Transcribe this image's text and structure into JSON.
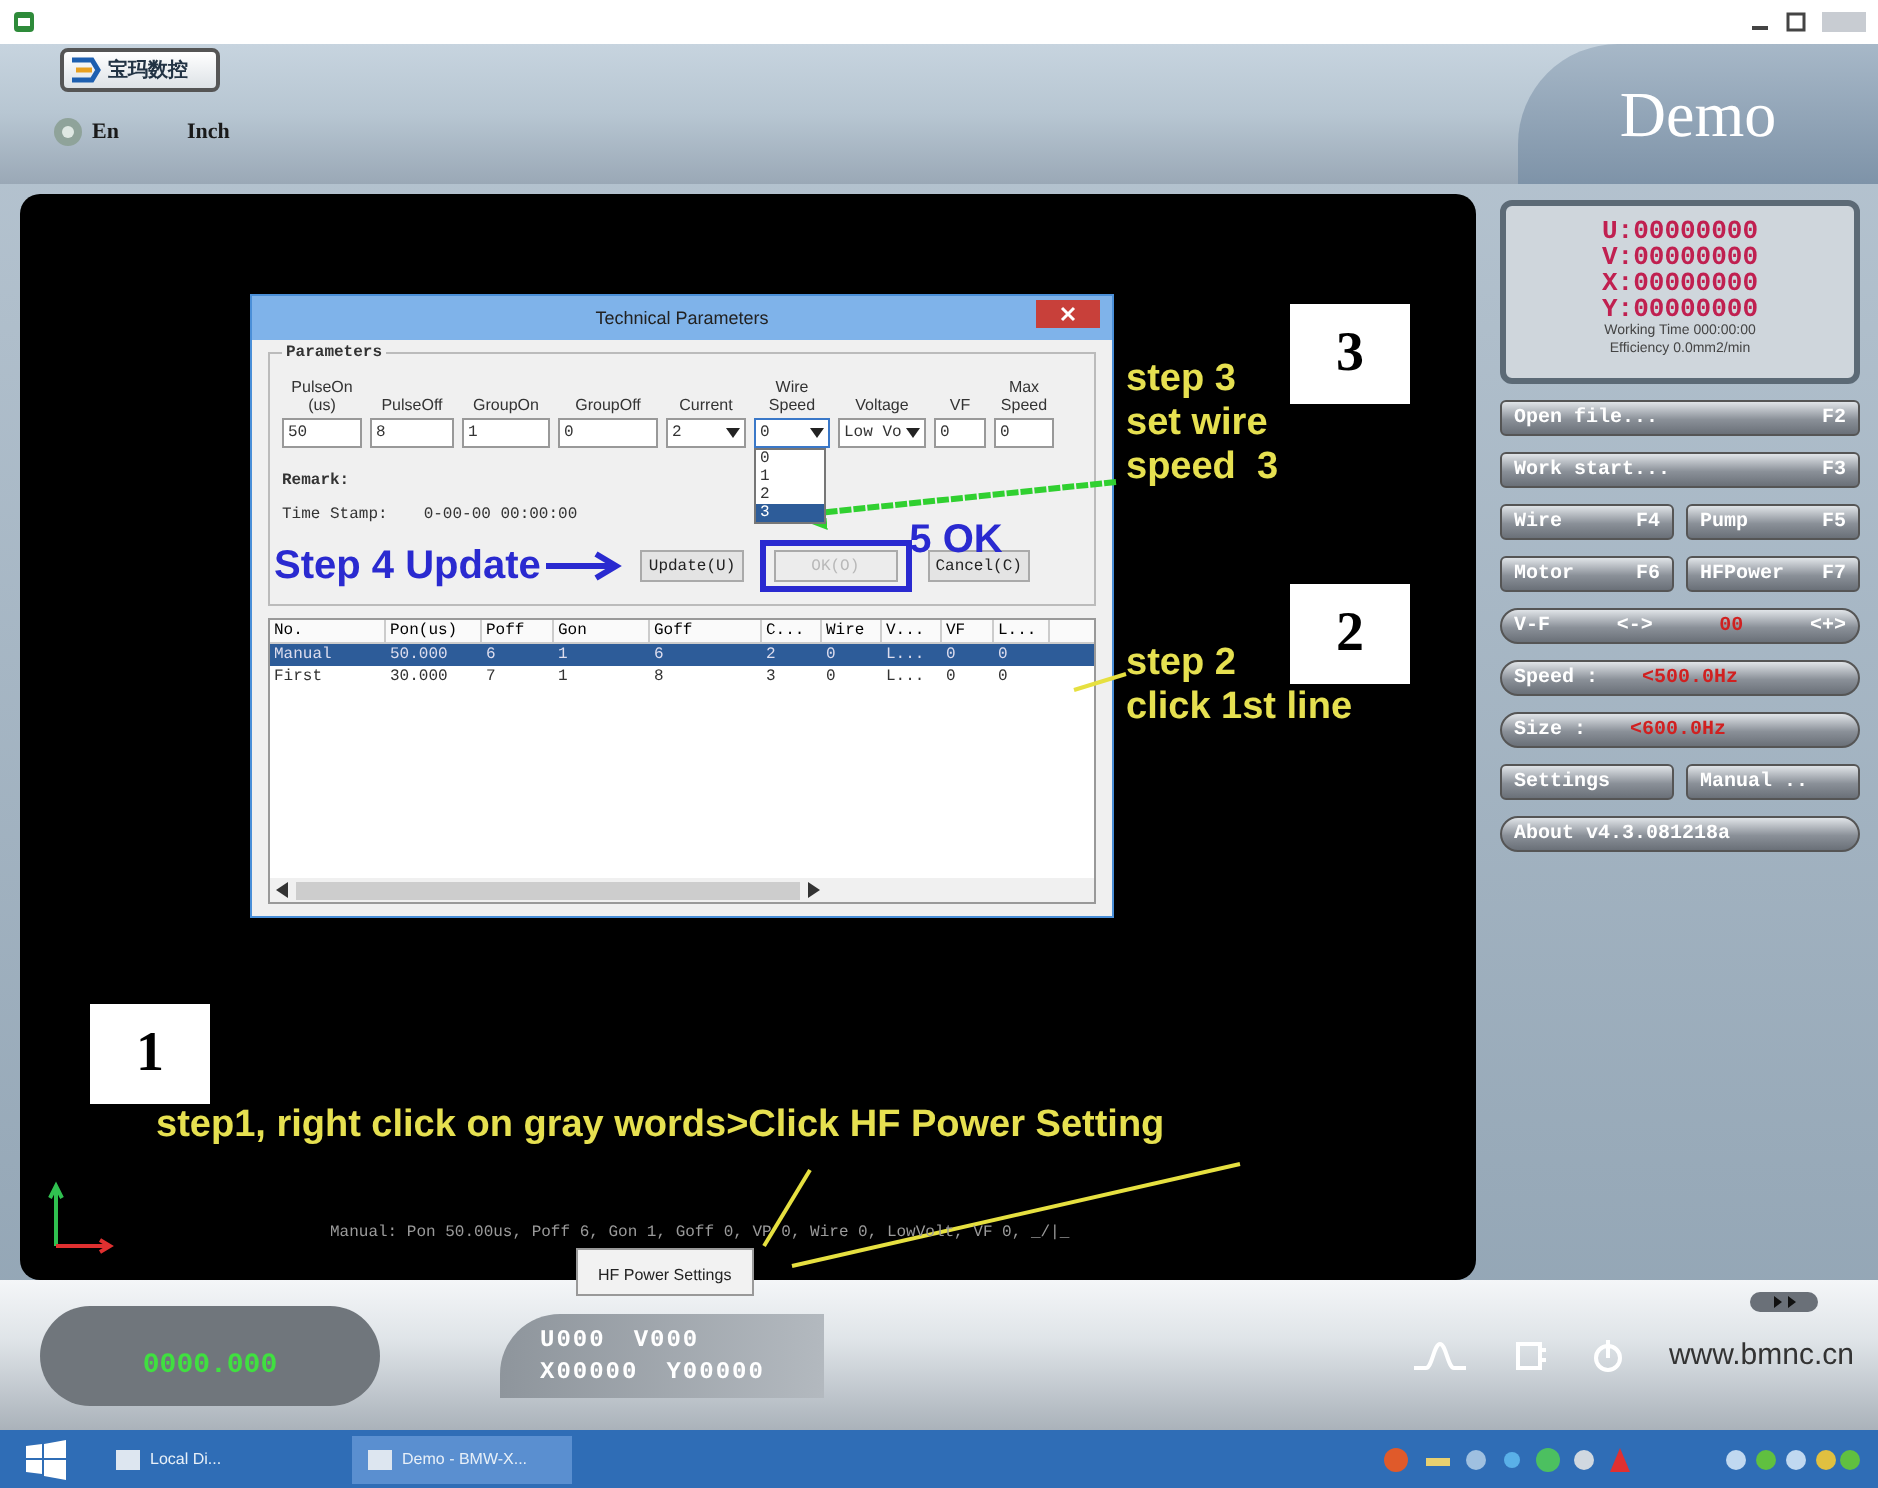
{
  "header": {
    "logo_text": "宝玛数控",
    "menu": [
      "En",
      "Inch"
    ],
    "app_title": "Demo"
  },
  "dialog": {
    "title": "Technical Parameters",
    "group_label": "Parameters",
    "fields": [
      {
        "label": "PulseOn (us)",
        "value": "50",
        "kind": "text"
      },
      {
        "label": "PulseOff",
        "value": "8",
        "kind": "text"
      },
      {
        "label": "GroupOn",
        "value": "1",
        "kind": "text"
      },
      {
        "label": "GroupOff",
        "value": "0",
        "kind": "text"
      },
      {
        "label": "Current",
        "value": "2",
        "kind": "combo",
        "expanded": false
      },
      {
        "label": "Wire Speed",
        "value": "0",
        "kind": "combo",
        "expanded": true
      },
      {
        "label": "Voltage",
        "value": "Low Vo",
        "kind": "combo",
        "expanded": false
      },
      {
        "label": "VF",
        "value": "0",
        "kind": "text"
      },
      {
        "label": "Max Speed",
        "value": "0",
        "kind": "text"
      }
    ],
    "dropdown_options": [
      {
        "label": "0",
        "selected": false
      },
      {
        "label": "1",
        "selected": false
      },
      {
        "label": "2",
        "selected": false
      },
      {
        "label": "3",
        "selected": true
      }
    ],
    "remark_label": "Remark:",
    "time_stamp_label": "Time Stamp:",
    "time_stamp": "0-00-00 00:00:00",
    "buttons": [
      {
        "label": "Update(U)",
        "disabled": false
      },
      {
        "label": "OK(O)",
        "disabled": true
      },
      {
        "label": "Cancel(C)",
        "disabled": false
      }
    ],
    "table": {
      "columns": [
        "No.",
        "Pon(us)",
        "Poff",
        "Gon",
        "Goff",
        "C...",
        "Wire",
        "V...",
        "VF",
        "L..."
      ],
      "rows": [
        {
          "selected": true,
          "cells": [
            "Manual",
            "50.000",
            "6",
            "1",
            "6",
            "2",
            "0",
            "L...",
            "0",
            "0"
          ]
        },
        {
          "selected": false,
          "cells": [
            "First",
            "30.000",
            "7",
            "1",
            "8",
            "3",
            "0",
            "L...",
            "0",
            "0"
          ]
        }
      ]
    }
  },
  "annotations": {
    "step_numbers": [
      "3",
      "2",
      "1"
    ],
    "step3_text": "step 3\nset wire\nspeed  3",
    "step2_text": "step 2\nclick 1st line",
    "step1_text": "step1, right click on gray words>Click HF Power Setting",
    "step4_text": "Step 4 Update",
    "step5_text": "5 OK"
  },
  "status_text": "Manual: Pon 50.00us, Poff 6, Gon 1, Goff 0, VP 0, Wire 0, LowVolt, VF 0, _/|_",
  "context_menu": [
    "HF Power Settings"
  ],
  "display": {
    "lines": [
      "U:00000000",
      "V:00000000",
      "X:00000000",
      "Y:00000000"
    ],
    "working_time": "Working Time 000:00:00",
    "efficiency": "Efficiency 0.0mm2/min"
  },
  "control_rows": [
    {
      "buttons": [
        {
          "kind": "function",
          "label": "Open file...",
          "key": "F2"
        }
      ]
    },
    {
      "buttons": [
        {
          "kind": "function",
          "label": "Work start...",
          "key": "F3"
        }
      ]
    },
    {
      "buttons": [
        {
          "kind": "function",
          "label": "Wire",
          "key": "F4"
        },
        {
          "kind": "function",
          "label": "Pump",
          "key": "F5"
        }
      ]
    },
    {
      "buttons": [
        {
          "kind": "function",
          "label": "Motor",
          "key": "F6"
        },
        {
          "kind": "function",
          "label": "HFPower",
          "key": "F7"
        }
      ]
    },
    {
      "buttons": [
        {
          "kind": "adjust",
          "label": "V-F",
          "minus": "<->",
          "value": "00",
          "plus": "<+>"
        }
      ]
    },
    {
      "buttons": [
        {
          "kind": "reading",
          "label": "Speed :",
          "value": "<500.0Hz"
        }
      ]
    },
    {
      "buttons": [
        {
          "kind": "reading",
          "label": "Size :",
          "value": "<600.0Hz"
        }
      ]
    },
    {
      "buttons": [
        {
          "kind": "plain",
          "label": "Settings"
        },
        {
          "kind": "plain",
          "label": "Manual .."
        }
      ]
    },
    {
      "buttons": [
        {
          "kind": "plain",
          "label": "About v4.3.081218a"
        }
      ]
    }
  ],
  "readout": "0000.000",
  "coordinates": [
    [
      "U000",
      "V000"
    ],
    [
      "X00000",
      "Y00000"
    ]
  ],
  "website": "www.bmnc.cn",
  "taskbar": {
    "tasks": [
      {
        "label": "Local Di...",
        "selected": false
      },
      {
        "label": "Demo - BMW-X...",
        "selected": true
      }
    ]
  }
}
